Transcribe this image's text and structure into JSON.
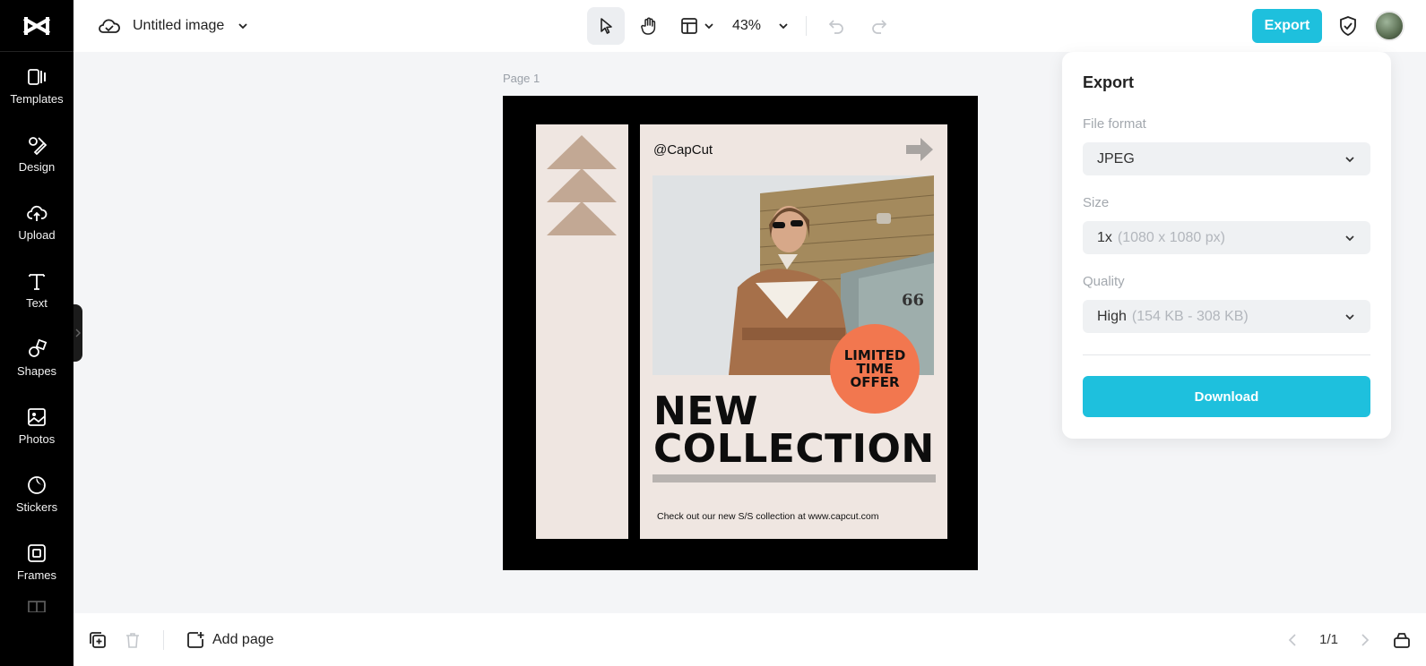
{
  "sidebar": {
    "items": [
      {
        "label": "Templates",
        "icon": "templates-icon"
      },
      {
        "label": "Design",
        "icon": "design-icon"
      },
      {
        "label": "Upload",
        "icon": "upload-icon"
      },
      {
        "label": "Text",
        "icon": "text-icon"
      },
      {
        "label": "Shapes",
        "icon": "shapes-icon"
      },
      {
        "label": "Photos",
        "icon": "photos-icon"
      },
      {
        "label": "Stickers",
        "icon": "stickers-icon"
      },
      {
        "label": "Frames",
        "icon": "frames-icon"
      }
    ]
  },
  "topbar": {
    "title": "Untitled image",
    "zoom": "43%",
    "export_label": "Export"
  },
  "canvas": {
    "page_label": "Page 1",
    "design": {
      "handle": "@CapCut",
      "headline_line1": "NEW",
      "headline_line2": "COLLECTION",
      "badge_line1": "LIMITED",
      "badge_line2": "TIME",
      "badge_line3": "OFFER",
      "house_number": "66",
      "tagline": "Check out our new S/S collection at www.capcut.com"
    }
  },
  "export_panel": {
    "title": "Export",
    "file_format": {
      "label": "File format",
      "value": "JPEG"
    },
    "size": {
      "label": "Size",
      "value": "1x",
      "detail": "(1080 x 1080 px)"
    },
    "quality": {
      "label": "Quality",
      "value": "High",
      "detail": "(154 KB - 308 KB)"
    },
    "download_label": "Download"
  },
  "bottombar": {
    "add_page_label": "Add page",
    "pager": "1/1"
  },
  "colors": {
    "accent": "#1ec0dd",
    "badge": "#f2774f",
    "panel_beige": "#efe6e1",
    "sidebar": "#000000"
  }
}
